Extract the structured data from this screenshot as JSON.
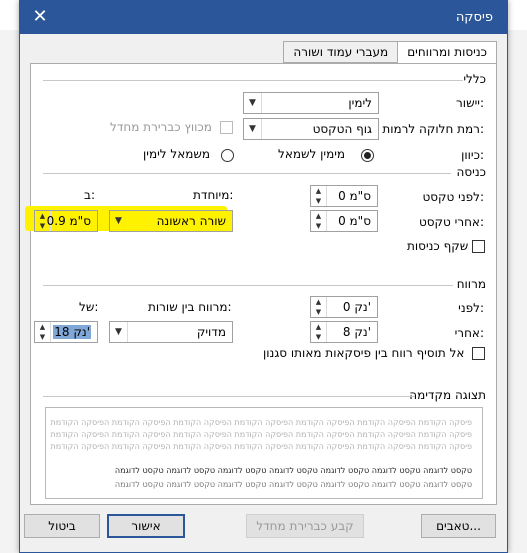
{
  "dialog": {
    "title": "פיסקה",
    "close_glyph": "✕"
  },
  "tabs": [
    {
      "label": "כניסות ומרווחים",
      "active": true
    },
    {
      "label": "מעברי עמוד ושורה",
      "active": false
    }
  ],
  "general": {
    "section_title": "כללי",
    "alignment_label": "יישור:",
    "alignment_value": "לימין",
    "outline_label": "רמת חלוקה לרמות:",
    "outline_value": "גוף הטקסט",
    "collapsed_label": "מכווץ כברירת מחדל",
    "direction_label": "כיוון:",
    "rtl_label": "מימין לשמאל",
    "ltr_label": "משמאל לימין"
  },
  "indentation": {
    "section_title": "כניסה",
    "before_label": "לפני טקסט:",
    "before_value": "0 ס\"מ",
    "after_label": "אחרי טקסט:",
    "after_value": "0 ס\"מ",
    "special_label": "מיוחדת:",
    "special_value": "שורה ראשונה",
    "by_label": "ב:",
    "by_value": "0.9 ס\"מ",
    "mirror_label": "שקף כניסות"
  },
  "spacing": {
    "section_title": "מרווח",
    "before_label": "לפני:",
    "before_value": "0 נק'",
    "after_label": "אחרי:",
    "after_value": "8 נק'",
    "line_label": "מרווח בין שורות:",
    "line_value": "מדויק",
    "at_label": "של:",
    "at_value": "18 נק'",
    "dont_add_label": "אל תוסיף רווח בין פיסקאות מאותו סגנון"
  },
  "preview": {
    "section_title": "תצוגה מקדימה",
    "prev_para": "פיסקה הקודמת הפיסקה הקודמת הפיסקה הקודמת הפיסקה הקודמת הפיסקה הקודמת הפיסקה הקודמת הפיסקה הקודמת",
    "sample_text": "טקסט לדוגמה טקסט לדוגמה טקסט לדוגמה טקסט לדוגמה טקסט לדוגמה טקסט לדוגמה טקסט לדוגמה"
  },
  "buttons": {
    "tabs": "טאבים...",
    "set_default": "קבע כברירת מחדל",
    "ok": "אישור",
    "cancel": "ביטול"
  },
  "colors": {
    "title_bar": "#2b579a",
    "highlight": "#fff200"
  }
}
